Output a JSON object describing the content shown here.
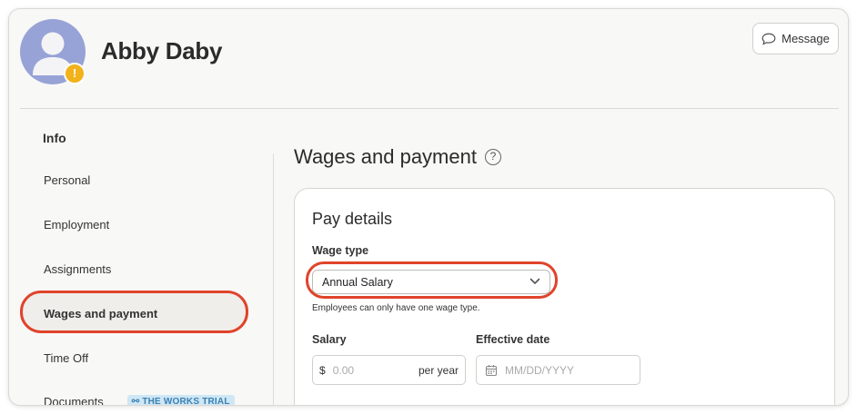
{
  "header": {
    "name": "Abby Daby",
    "avatar_badge": "!",
    "message_label": "Message"
  },
  "sidebar": {
    "heading": "Info",
    "items": [
      {
        "label": "Personal"
      },
      {
        "label": "Employment"
      },
      {
        "label": "Assignments"
      },
      {
        "label": "Wages and payment",
        "active": true
      },
      {
        "label": "Time Off"
      },
      {
        "label": "Documents",
        "badge": "THE WORKS TRIAL"
      }
    ]
  },
  "main": {
    "title": "Wages and payment",
    "help_symbol": "?",
    "card": {
      "title": "Pay details",
      "wage_type_label": "Wage type",
      "wage_type_value": "Annual Salary",
      "wage_type_hint": "Employees can only have one wage type.",
      "salary_label": "Salary",
      "salary_currency": "$",
      "salary_placeholder": "0.00",
      "salary_unit": "per year",
      "effective_date_label": "Effective date",
      "effective_date_placeholder": "MM/DD/YYYY"
    }
  },
  "colors": {
    "highlight": "#e0432a",
    "avatar": "#97a3d6",
    "badge": "#f2b21b",
    "trial_badge_bg": "#cfe7f5",
    "trial_badge_text": "#3b80b3"
  },
  "icons": {
    "avatar": "person-silhouette",
    "avatar_badge": "warning-badge",
    "message": "chat-bubble-icon",
    "help": "question-circle-icon",
    "select": "chevron-down-icon",
    "date": "calendar-icon",
    "trial": "link-icon"
  }
}
